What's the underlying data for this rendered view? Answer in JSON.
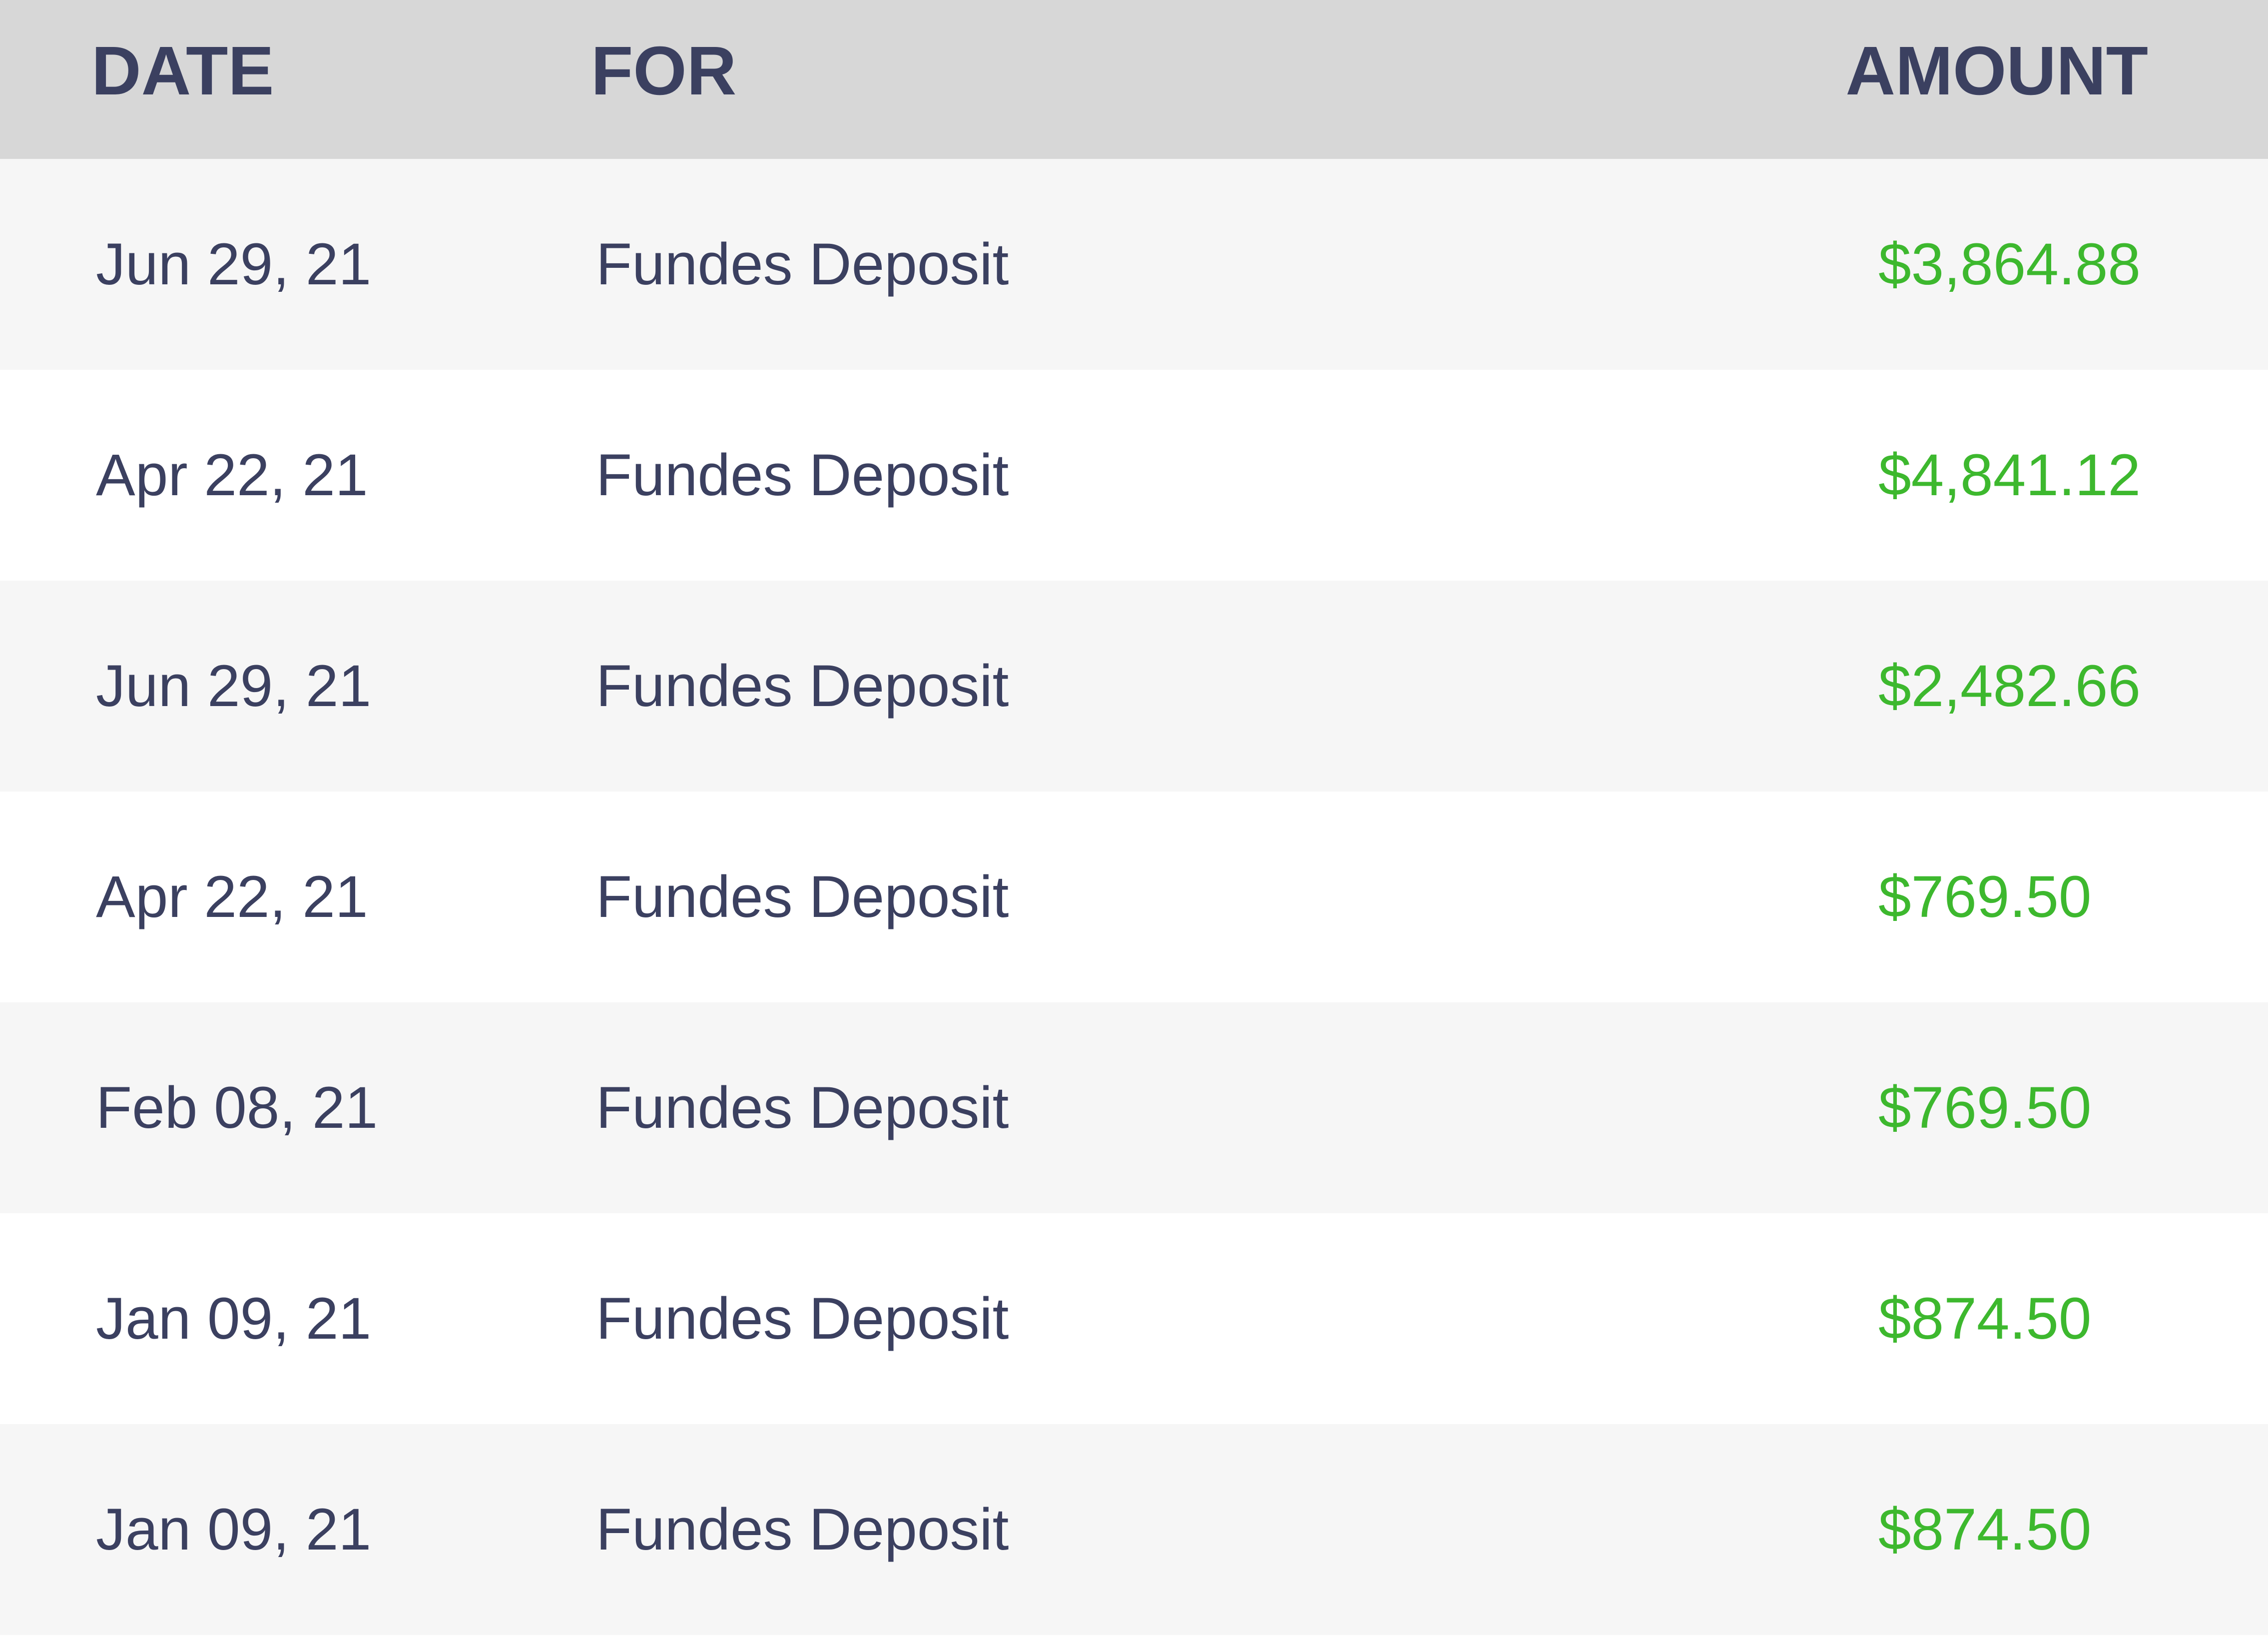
{
  "table": {
    "headers": {
      "date": "DATE",
      "for": "FOR",
      "amount": "AMOUNT"
    },
    "rows": [
      {
        "date": "Jun 29, 21",
        "for": "Fundes Deposit",
        "amount": "$3,864.88"
      },
      {
        "date": "Apr 22, 21",
        "for": "Fundes Deposit",
        "amount": "$4,841.12"
      },
      {
        "date": "Jun 29, 21",
        "for": "Fundes Deposit",
        "amount": "$2,482.66"
      },
      {
        "date": "Apr 22, 21",
        "for": "Fundes Deposit",
        "amount": "$769.50"
      },
      {
        "date": "Feb 08, 21",
        "for": "Fundes Deposit",
        "amount": "$769.50"
      },
      {
        "date": "Jan 09, 21",
        "for": "Fundes Deposit",
        "amount": "$874.50"
      },
      {
        "date": "Jan 09, 21",
        "for": "Fundes Deposit",
        "amount": "$874.50"
      }
    ]
  },
  "colors": {
    "header_bg": "#d7d7d7",
    "row_alt_bg": "#f6f6f6",
    "text": "#3b4060",
    "amount": "#3db82e"
  }
}
